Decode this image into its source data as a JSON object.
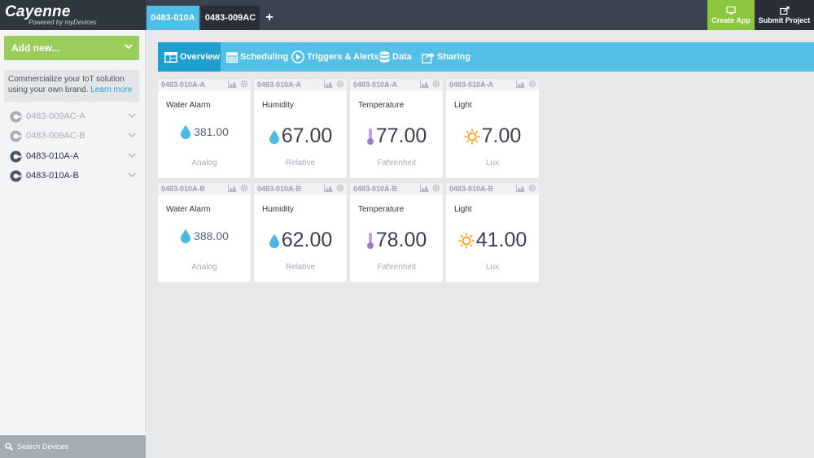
{
  "brand": {
    "name": "Cayenne",
    "tagline": "Powered by myDevices"
  },
  "top_tabs": {
    "active": "0483-010A",
    "inactive": "0483-009AC",
    "add": "+"
  },
  "top_buttons": {
    "create_app": "Create App",
    "submit_project": "Submit Project"
  },
  "colors": {
    "accent": "#54c0e8",
    "accent_dark": "#1f9fd0",
    "green": "#8cc63f",
    "topbar": "#3b4250"
  },
  "sidebar": {
    "add_new": "Add new...",
    "promo_text": "Commercialize your IoT solution using your own brand.",
    "promo_link": "Learn more",
    "devices": [
      {
        "label": "0483-009AC-A"
      },
      {
        "label": "0483-009AC-B"
      },
      {
        "label": "0483-010A-A"
      },
      {
        "label": "0483-010A-B"
      }
    ],
    "search": "Search Devices"
  },
  "nav": {
    "items": [
      {
        "label": "Overview",
        "icon": "dashboard-icon"
      },
      {
        "label": "Scheduling",
        "icon": "calendar-icon"
      },
      {
        "label": "Triggers & Alerts",
        "icon": "play-icon"
      },
      {
        "label": "Data",
        "icon": "database-icon"
      },
      {
        "label": "Sharing",
        "icon": "share-icon"
      }
    ]
  },
  "cards": [
    {
      "device": "0483-010A-A",
      "title": "Water Alarm",
      "value": "381.00",
      "unit": "Analog",
      "icon": "water-drop-icon"
    },
    {
      "device": "0483-010A-A",
      "title": "Humidity",
      "value": "67.00",
      "unit": "Relative",
      "icon": "water-drop-icon"
    },
    {
      "device": "0483-010A-A",
      "title": "Temperature",
      "value": "77.00",
      "unit": "Fahrenheit",
      "icon": "thermometer-icon"
    },
    {
      "device": "0483-010A-A",
      "title": "Light",
      "value": "7.00",
      "unit": "Lux",
      "icon": "sun-icon"
    },
    {
      "device": "0483-010A-B",
      "title": "Water Alarm",
      "value": "388.00",
      "unit": "Analog",
      "icon": "water-drop-icon"
    },
    {
      "device": "0483-010A-B",
      "title": "Humidity",
      "value": "62.00",
      "unit": "Relative",
      "icon": "water-drop-icon"
    },
    {
      "device": "0483-010A-B",
      "title": "Temperature",
      "value": "78.00",
      "unit": "Fahrenheit",
      "icon": "thermometer-icon"
    },
    {
      "device": "0483-010A-B",
      "title": "Light",
      "value": "41.00",
      "unit": "Lux",
      "icon": "sun-icon"
    }
  ]
}
